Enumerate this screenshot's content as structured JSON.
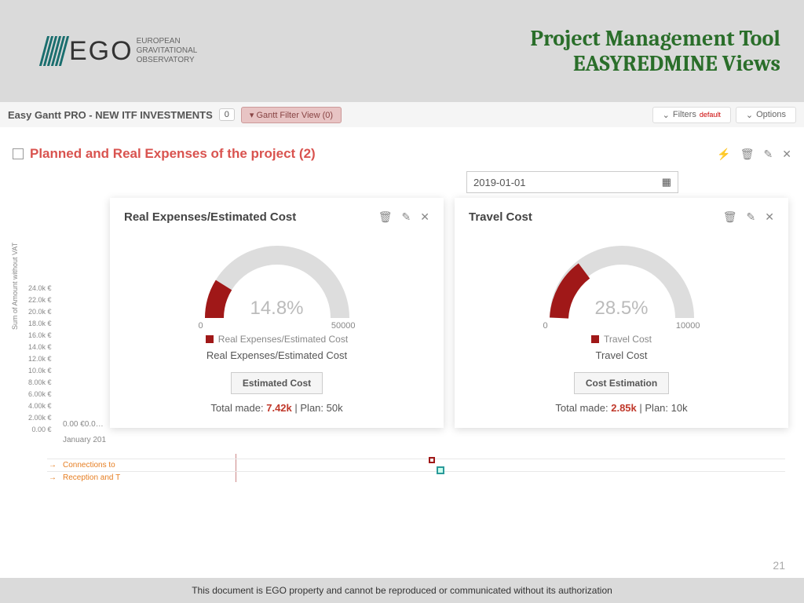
{
  "header": {
    "logo_main": "EGO",
    "logo_sub1": "EUROPEAN",
    "logo_sub2": "GRAVITATIONAL",
    "logo_sub3": "OBSERVATORY",
    "title_line1": "Project Management Tool",
    "title_line2": "EASYREDMINE Views"
  },
  "toolbar": {
    "title": "Easy Gantt PRO - NEW ITF INVESTMENTS",
    "badge": "0",
    "filter_btn": "Gantt Filter View (0)",
    "filters_label": "Filters",
    "filters_tag": "default",
    "options_label": "Options"
  },
  "section": {
    "title": "Planned and Real Expenses of the project (2)"
  },
  "date_field": "2019-01-01",
  "cards": [
    {
      "title": "Real Expenses/Estimated Cost",
      "pct": "14.8%",
      "min": "0",
      "max": "50000",
      "legend": "Real Expenses/Estimated Cost",
      "sub": "Real Expenses/Estimated Cost",
      "btn": "Estimated Cost",
      "total_prefix": "Total made: ",
      "made": "7.42k",
      "plan": " | Plan: 50k"
    },
    {
      "title": "Travel Cost",
      "pct": "28.5%",
      "min": "0",
      "max": "10000",
      "legend": "Travel Cost",
      "sub": "Travel Cost",
      "btn": "Cost Estimation",
      "total_prefix": "Total made: ",
      "made": "2.85k",
      "plan": " | Plan: 10k"
    }
  ],
  "y_axis": [
    "24.0k €",
    "22.0k €",
    "20.0k €",
    "18.0k €",
    "16.0k €",
    "14.0k €",
    "12.0k €",
    "10.0k €",
    "8.00k €",
    "6.00k €",
    "4.00k €",
    "2.00k €",
    "0.00 €"
  ],
  "y_label": "Sum of Amount without VAT",
  "x_origin": "0.00 €0.0…",
  "x_jan": "January 201",
  "gantt": {
    "row1": "Connections to",
    "row2": "Reception and T"
  },
  "footer": "This document is EGO property and cannot be reproduced or communicated without its authorization",
  "page": "21",
  "chart_data": [
    {
      "type": "gauge",
      "title": "Real Expenses/Estimated Cost",
      "value_pct": 14.8,
      "value": 7420,
      "min": 0,
      "max": 50000,
      "plan": 50000,
      "color": "#a01818"
    },
    {
      "type": "gauge",
      "title": "Travel Cost",
      "value_pct": 28.5,
      "value": 2850,
      "min": 0,
      "max": 10000,
      "plan": 10000,
      "color": "#a01818"
    }
  ]
}
